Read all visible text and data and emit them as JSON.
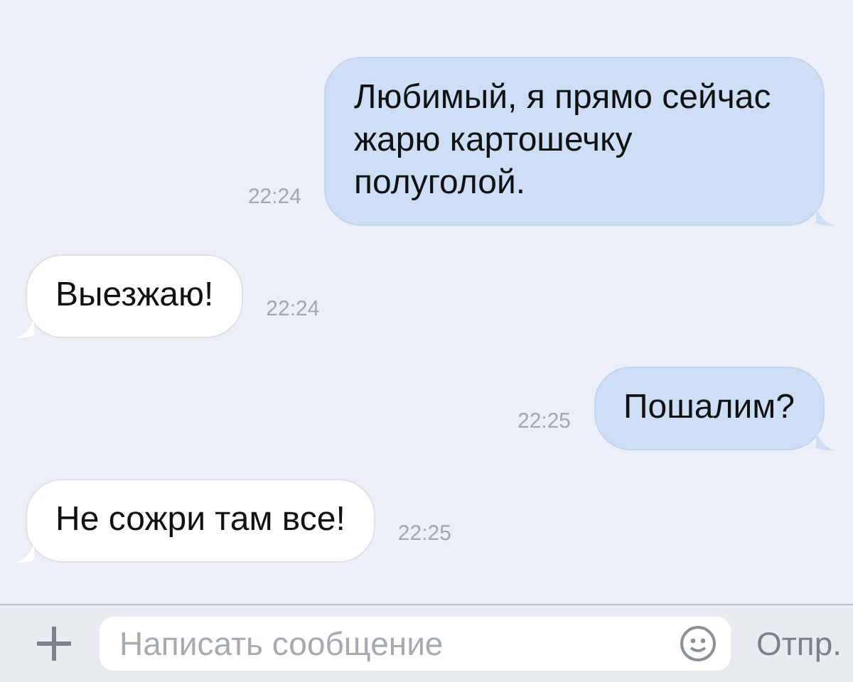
{
  "messages": [
    {
      "kind": "out",
      "text": "Любимый, я прямо сейчас жарю картошечку полуголой.",
      "time": "22:24"
    },
    {
      "kind": "in",
      "text": "Выезжаю!",
      "time": "22:24"
    },
    {
      "kind": "out",
      "text": "Пошалим?",
      "time": "22:25"
    },
    {
      "kind": "in",
      "text": "Не сожри там все!",
      "time": "22:25"
    }
  ],
  "composer": {
    "placeholder": "Написать сообщение",
    "send": "Отпр."
  }
}
